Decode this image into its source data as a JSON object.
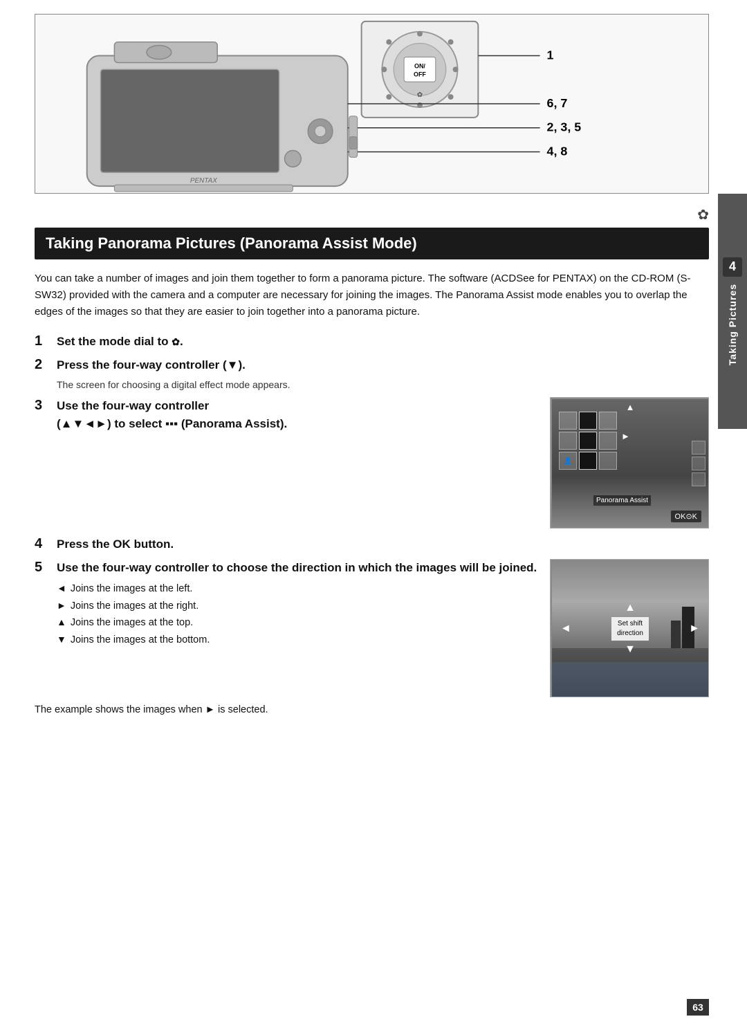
{
  "page": {
    "number": "63"
  },
  "sidebar": {
    "number": "4",
    "label": "Taking Pictures"
  },
  "diagram": {
    "labels": [
      "1",
      "6, 7",
      "2, 3, 5",
      "4, 8"
    ]
  },
  "section_icon": "✿",
  "heading": "Taking Panorama Pictures (Panorama Assist Mode)",
  "intro": "You can take a number of images and join them together to form a panorama picture. The software (ACDSee for PENTAX) on the CD-ROM (S-SW32) provided with the camera and a computer are necessary for joining the images. The Panorama Assist mode enables you to overlap the edges of the images so that they are easier to join together into a panorama picture.",
  "steps": [
    {
      "number": "1",
      "text": "Set the mode dial to ✿."
    },
    {
      "number": "2",
      "text": "Press the four-way controller (▼).",
      "sub": "The screen for choosing a digital effect mode appears."
    },
    {
      "number": "3",
      "text": "Use the four-way controller (▲▼◄►) to select ▪▪▪ (Panorama Assist)."
    },
    {
      "number": "4",
      "text": "Press the OK button."
    },
    {
      "number": "5",
      "text": "Use the four-way controller to choose the direction in which the images will be joined."
    }
  ],
  "bullets": [
    {
      "bullet": "◄",
      "text": "Joins the images at the left."
    },
    {
      "bullet": "►",
      "text": "Joins the images at the right."
    },
    {
      "bullet": "▲",
      "text": "Joins the images at the top."
    },
    {
      "bullet": "▼",
      "text": "Joins the images at the bottom."
    }
  ],
  "example_note": "The example shows the images when ► is selected.",
  "panorama_screen": {
    "label": "Panorama Assist",
    "ok_text": "OK⊙K"
  },
  "shift_screen": {
    "label_line1": "Set shift",
    "label_line2": "direction"
  }
}
